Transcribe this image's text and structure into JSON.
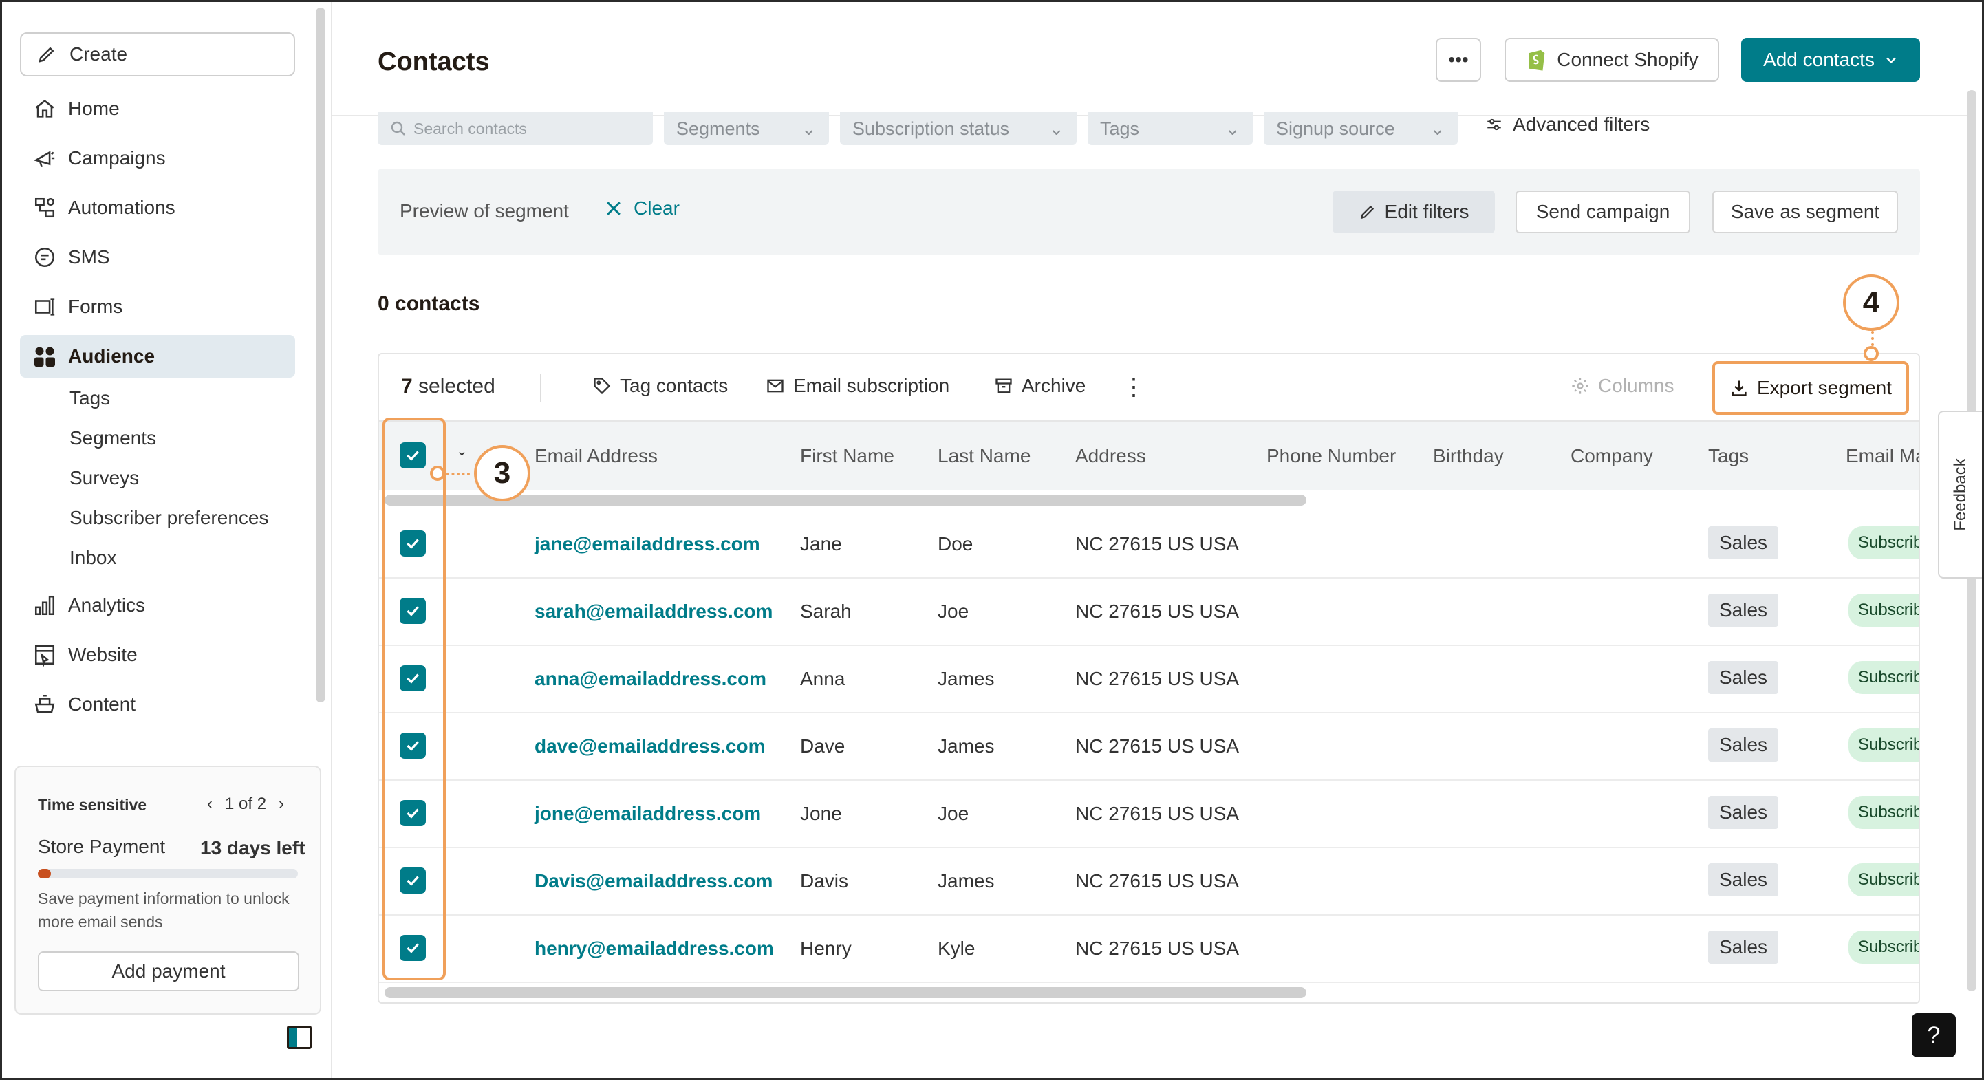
{
  "sidebar": {
    "create_label": "Create",
    "nav": [
      {
        "label": "Home",
        "icon": "home-icon"
      },
      {
        "label": "Campaigns",
        "icon": "megaphone-icon"
      },
      {
        "label": "Automations",
        "icon": "automation-icon"
      },
      {
        "label": "SMS",
        "icon": "sms-icon"
      },
      {
        "label": "Forms",
        "icon": "forms-icon"
      },
      {
        "label": "Audience",
        "icon": "audience-icon",
        "active": true
      },
      {
        "label": "Analytics",
        "icon": "analytics-icon"
      },
      {
        "label": "Website",
        "icon": "website-icon"
      },
      {
        "label": "Content",
        "icon": "content-icon"
      }
    ],
    "audience_sub": [
      "Tags",
      "Segments",
      "Surveys",
      "Subscriber preferences",
      "Inbox"
    ],
    "time_sensitive": {
      "title": "Time sensitive",
      "pager": "1 of 2",
      "item": "Store Payment",
      "days_left": "13 days left",
      "progress_fraction": 0.05,
      "description": "Save payment information to unlock more email sends",
      "button": "Add payment"
    }
  },
  "header": {
    "title": "Contacts",
    "more_label": "•••",
    "shopify_label": "Connect Shopify",
    "add_contacts_label": "Add contacts"
  },
  "filters": {
    "search_placeholder": "Search contacts",
    "dropdowns": [
      "Segments",
      "Subscription status",
      "Tags",
      "Signup source"
    ],
    "advanced": "Advanced filters"
  },
  "preview": {
    "text": "Preview of segment",
    "clear": "Clear",
    "edit_filters": "Edit filters",
    "send_campaign": "Send campaign",
    "save_segment": "Save as segment"
  },
  "count_label": "0 contacts",
  "toolbar": {
    "selected_count": "7",
    "selected_suffix": " selected",
    "tag_contacts": "Tag contacts",
    "email_subscription": "Email subscription",
    "archive": "Archive",
    "kebab": "⋮",
    "columns": "Columns",
    "export": "Export segment"
  },
  "table": {
    "headers": [
      "Email Address",
      "First Name",
      "Last Name",
      "Address",
      "Phone Number",
      "Birthday",
      "Company",
      "Tags",
      "Email Ma"
    ],
    "rows": [
      {
        "email": "jane@emailaddress.com",
        "first": "Jane",
        "last": "Doe",
        "address": "NC 27615 US USA",
        "tag": "Sales",
        "status": "Subscribed"
      },
      {
        "email": "sarah@emailaddress.com",
        "first": "Sarah",
        "last": "Joe",
        "address": "NC 27615 US USA",
        "tag": "Sales",
        "status": "Subscribed"
      },
      {
        "email": "anna@emailaddress.com",
        "first": "Anna",
        "last": "James",
        "address": "NC 27615 US USA",
        "tag": "Sales",
        "status": "Subscribed"
      },
      {
        "email": "dave@emailaddress.com",
        "first": "Dave",
        "last": "James",
        "address": "NC 27615 US USA",
        "tag": "Sales",
        "status": "Subscribed"
      },
      {
        "email": "jone@emailaddress.com",
        "first": "Jone",
        "last": "Joe",
        "address": "NC 27615 US USA",
        "tag": "Sales",
        "status": "Subscribed"
      },
      {
        "email": "Davis@emailaddress.com",
        "first": "Davis",
        "last": "James",
        "address": "NC 27615 US USA",
        "tag": "Sales",
        "status": "Subscribed"
      },
      {
        "email": "henry@emailaddress.com",
        "first": "Henry",
        "last": "Kyle",
        "address": "NC 27615 US USA",
        "tag": "Sales",
        "status": "Subscribed"
      }
    ]
  },
  "callouts": {
    "select": "3",
    "export": "4"
  },
  "feedback_label": "Feedback",
  "help_label": "?",
  "colors": {
    "brand": "#007c89",
    "highlight": "#f0a05a",
    "active_nav": "#e2eaef"
  }
}
